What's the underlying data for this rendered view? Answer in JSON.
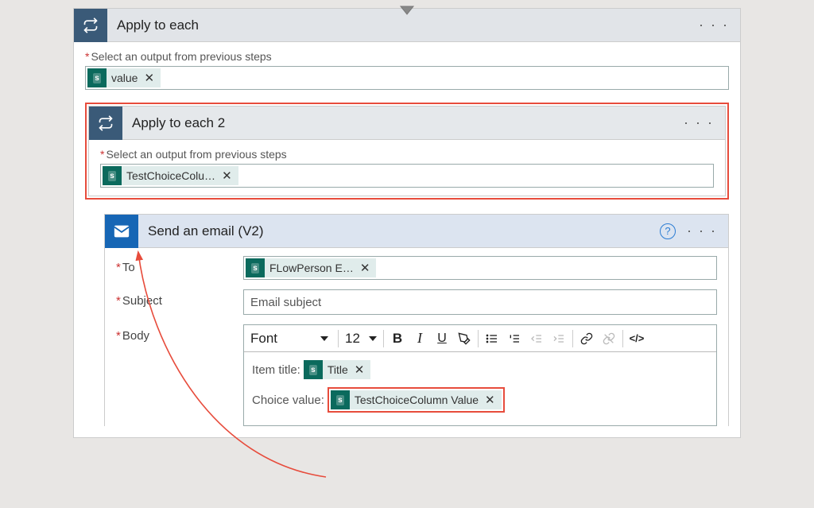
{
  "connector_glyph": "▼",
  "outer_loop": {
    "title": "Apply to each",
    "output_label": "Select an output from previous steps",
    "token": {
      "label": "value"
    }
  },
  "inner_loop": {
    "title": "Apply to each 2",
    "output_label": "Select an output from previous steps",
    "token": {
      "label": "TestChoiceColu…"
    }
  },
  "email": {
    "title": "Send an email (V2)",
    "to_label": "To",
    "to_token": {
      "label": "FLowPerson E…"
    },
    "subject_label": "Subject",
    "subject_value": "Email subject",
    "body_label": "Body",
    "toolbar": {
      "font": "Font",
      "size": "12"
    },
    "body": {
      "line1_prefix": "Item title:",
      "line1_token": "Title",
      "line2_prefix": "Choice value:",
      "line2_token": "TestChoiceColumn Value"
    }
  },
  "glyph": {
    "more": "· · ·",
    "close": "✕",
    "help": "?",
    "loop": "⇄",
    "bold": "B",
    "italic": "I",
    "underline": "U",
    "link": "🔗",
    "code": "</>"
  }
}
